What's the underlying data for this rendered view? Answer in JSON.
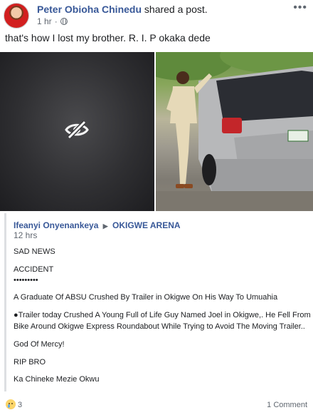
{
  "post": {
    "author": "Peter Obioha Chinedu",
    "action": "shared a post.",
    "timestamp": "1 hr",
    "privacy_icon": "globe-icon",
    "more_icon": "ellipsis-icon",
    "text": "that's how I lost my brother. R. I. P okaka dede"
  },
  "photos": {
    "hidden_icon": "eye-slash-icon"
  },
  "shared_post": {
    "author": "Ifeanyi Onyenankeya",
    "separator_icon": "triangle-right-icon",
    "group": "OKIGWE ARENA",
    "timestamp": "12 hrs",
    "lines": [
      "SAD NEWS",
      "ACCIDENT",
      "•••••••••",
      "A Graduate Of ABSU Crushed By Trailer in Okigwe On His Way To Umuahia",
      "●Trailer today Crushed A Young Full of Life Guy Named Joel in Okigwe,. He Fell From",
      "Bike Around Okigwe Express Roundabout While Trying to Avoid The Moving Trailer..",
      "God Of Mercy!",
      "RIP BRO",
      "Ka Chineke Mezie Okwu"
    ]
  },
  "footer": {
    "reaction_icon": "sad-reaction-icon",
    "reaction_count": "3",
    "comments": "1 Comment"
  }
}
